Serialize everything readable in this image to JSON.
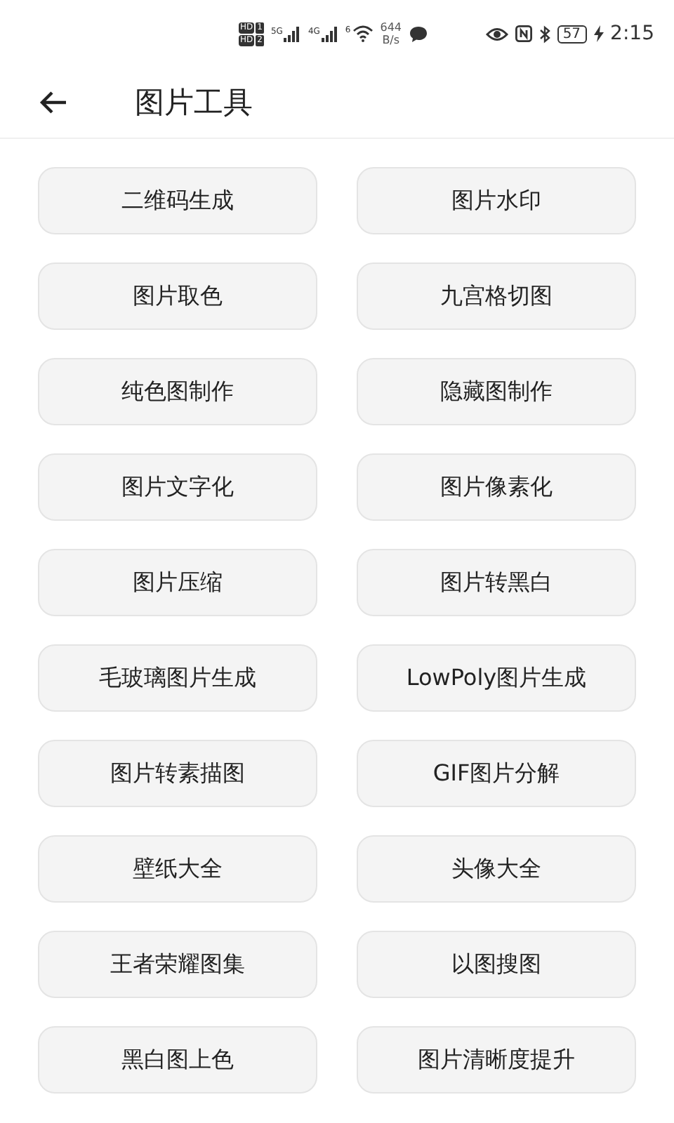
{
  "status_bar": {
    "sims": [
      {
        "badge": "HD",
        "slot": "1"
      },
      {
        "badge": "HD",
        "slot": "2"
      }
    ],
    "networks": [
      "5G",
      "4G"
    ],
    "wifi_label": "6",
    "speed": "644",
    "speed_unit": "B/s",
    "battery": "57",
    "charging": true,
    "time": "2:15"
  },
  "header": {
    "title": "图片工具"
  },
  "tools": [
    {
      "label": "二维码生成"
    },
    {
      "label": "图片水印"
    },
    {
      "label": "图片取色"
    },
    {
      "label": "九宫格切图"
    },
    {
      "label": "纯色图制作"
    },
    {
      "label": "隐藏图制作"
    },
    {
      "label": "图片文字化"
    },
    {
      "label": "图片像素化"
    },
    {
      "label": "图片压缩"
    },
    {
      "label": "图片转黑白"
    },
    {
      "label": "毛玻璃图片生成"
    },
    {
      "label": "LowPoly图片生成"
    },
    {
      "label": "图片转素描图"
    },
    {
      "label": "GIF图片分解"
    },
    {
      "label": "壁纸大全"
    },
    {
      "label": "头像大全"
    },
    {
      "label": "王者荣耀图集"
    },
    {
      "label": "以图搜图"
    },
    {
      "label": "黑白图上色"
    },
    {
      "label": "图片清晰度提升"
    }
  ]
}
